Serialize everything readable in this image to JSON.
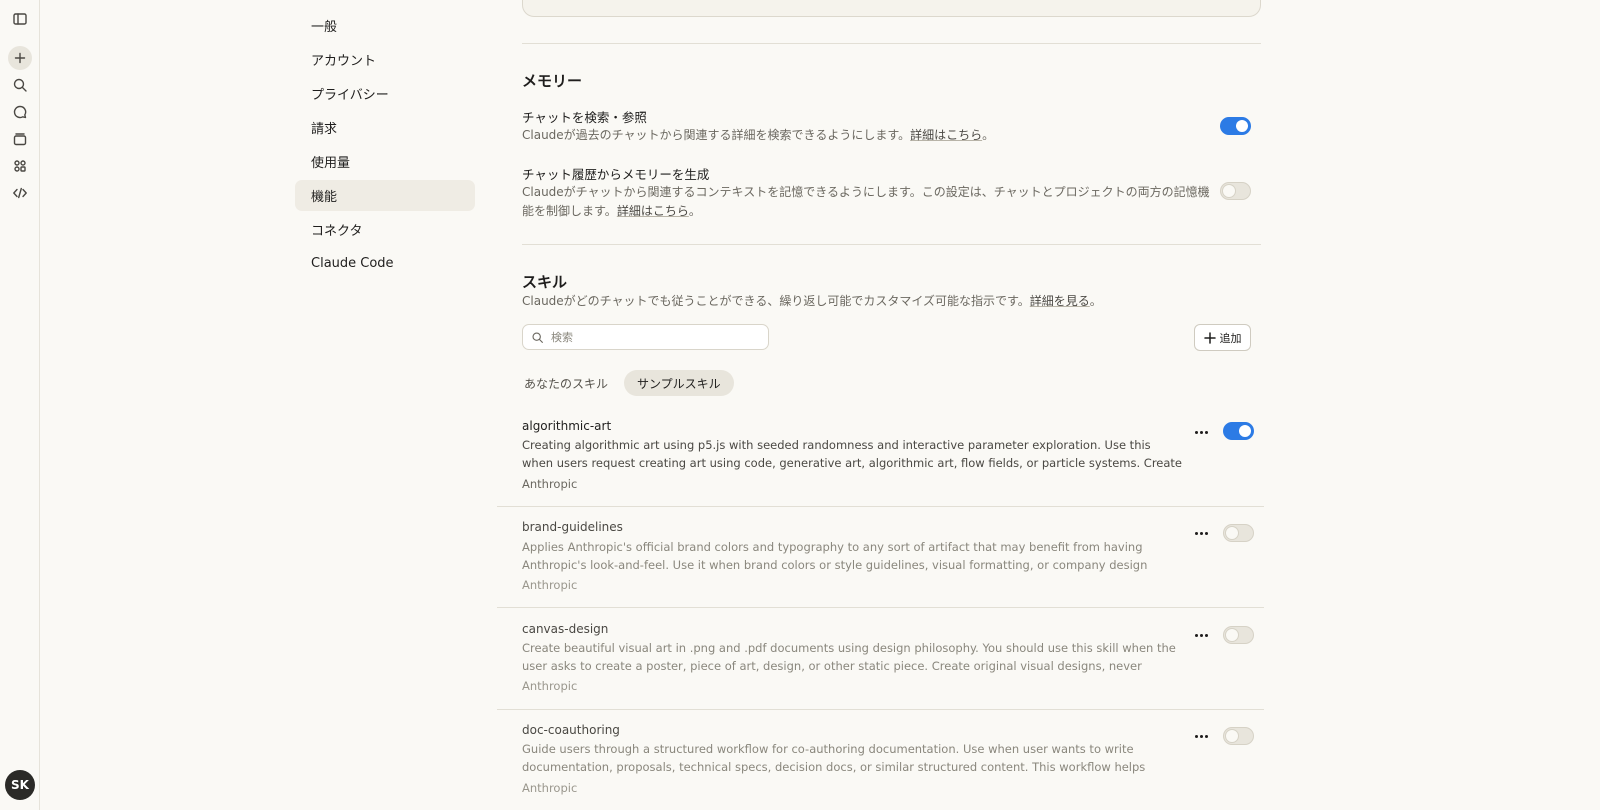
{
  "rail": {
    "avatar_initials": "SK",
    "icons": [
      "sidebar-toggle-icon",
      "plus-icon",
      "search-icon",
      "chat-icon",
      "projects-icon",
      "artifacts-icon",
      "code-icon"
    ]
  },
  "settings_nav": {
    "items": [
      {
        "label": "一般"
      },
      {
        "label": "アカウント"
      },
      {
        "label": "プライバシー"
      },
      {
        "label": "請求"
      },
      {
        "label": "使用量"
      },
      {
        "label": "機能",
        "active": true
      },
      {
        "label": "コネクタ"
      },
      {
        "label": "Claude Code"
      }
    ]
  },
  "memory": {
    "title": "メモリー",
    "search_chats": {
      "title": "チャットを検索・参照",
      "desc": "Claudeが過去のチャットから関連する詳細を検索できるようにします。",
      "link": "詳細はこちら",
      "suffix": "。",
      "enabled": true
    },
    "generate_memory": {
      "title": "チャット履歴からメモリーを生成",
      "desc": "Claudeがチャットから関連するコンテキストを記憶できるようにします。この設定は、チャットとプロジェクトの両方の記憶機能を制御します。",
      "link": "詳細はこちら",
      "suffix": "。",
      "enabled": false
    }
  },
  "skills": {
    "title": "スキル",
    "desc": "Claudeがどのチャットでも従うことができる、繰り返し可能でカスタマイズ可能な指示です。",
    "link": "詳細を見る",
    "suffix": "。",
    "search_placeholder": "検索",
    "add_label": "追加",
    "tabs": [
      {
        "label": "あなたのスキル",
        "active": false
      },
      {
        "label": "サンプルスキル",
        "active": true
      }
    ],
    "items": [
      {
        "name": "algorithmic-art",
        "desc": "Creating algorithmic art using p5.js with seeded randomness and interactive parameter exploration. Use this when users request creating art using code, generative art, algorithmic art, flow fields, or particle systems. Create original algorithmi…",
        "author": "Anthropic",
        "enabled": true
      },
      {
        "name": "brand-guidelines",
        "desc": "Applies Anthropic's official brand colors and typography to any sort of artifact that may benefit from having Anthropic's look-and-feel. Use it when brand colors or style guidelines, visual formatting, or company design standards apply.",
        "author": "Anthropic",
        "enabled": false
      },
      {
        "name": "canvas-design",
        "desc": "Create beautiful visual art in .png and .pdf documents using design philosophy. You should use this skill when the user asks to create a poster, piece of art, design, or other static piece. Create original visual designs, never copying existing…",
        "author": "Anthropic",
        "enabled": false
      },
      {
        "name": "doc-coauthoring",
        "desc": "Guide users through a structured workflow for co-authoring documentation. Use when user wants to write documentation, proposals, technical specs, decision docs, or similar structured content. This workflow helps users…",
        "author": "Anthropic",
        "enabled": false
      }
    ]
  },
  "colors": {
    "toggle_on": "#2c7be5",
    "background": "#faf9f5"
  }
}
